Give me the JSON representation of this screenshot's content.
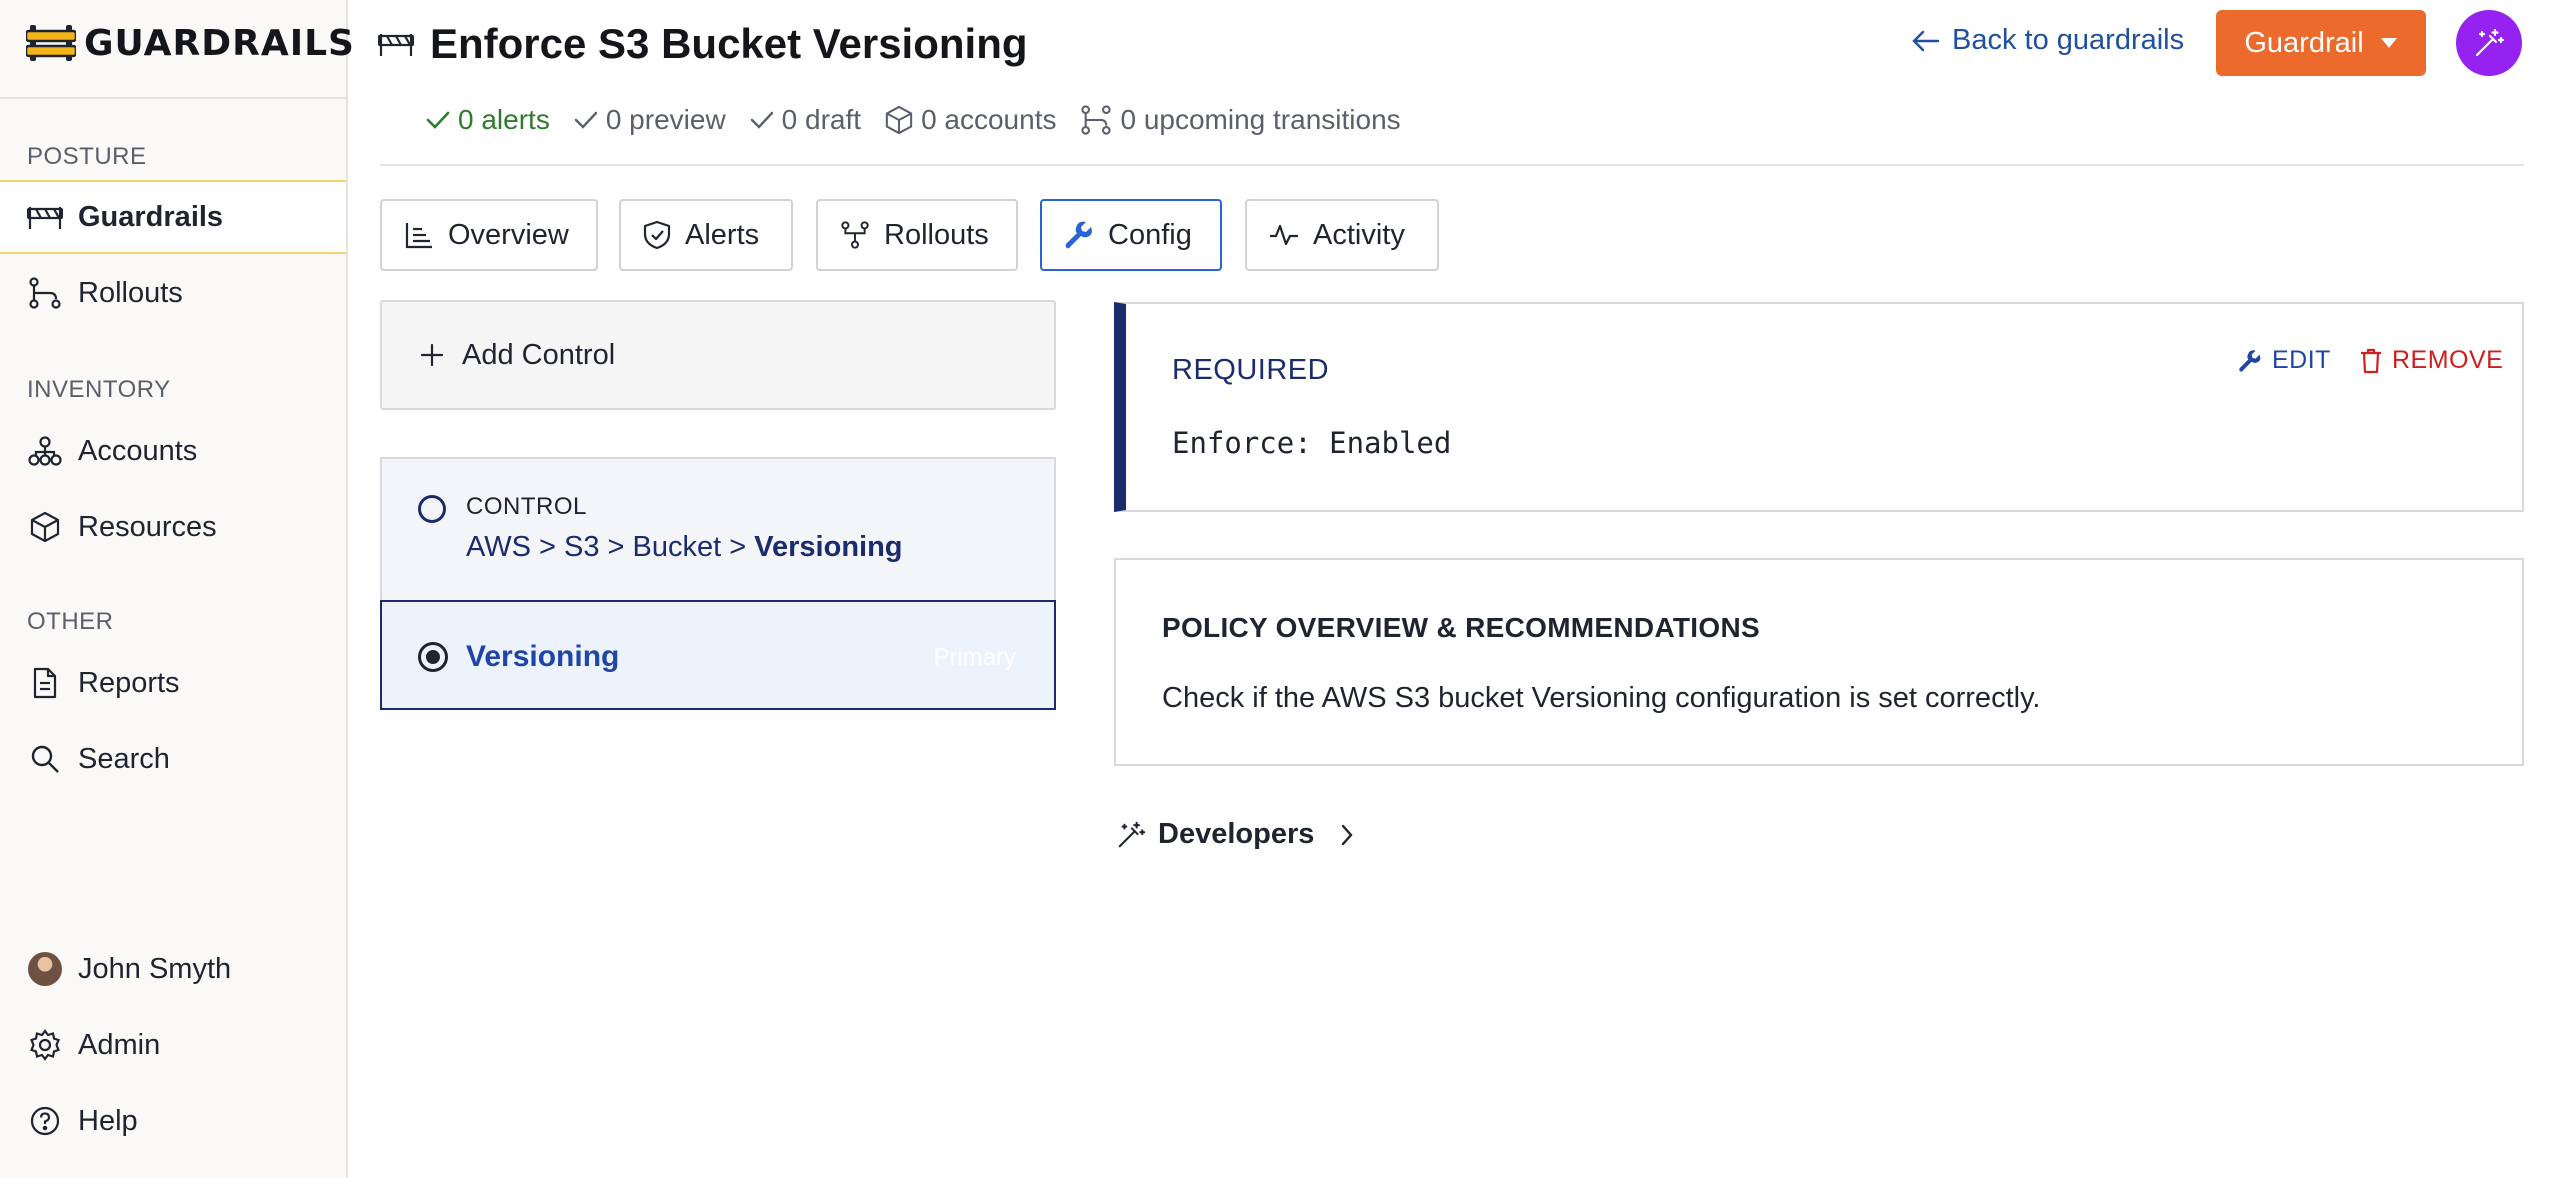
{
  "brand": {
    "name": "GUARDRAILS"
  },
  "sidebar": {
    "sections": [
      {
        "label": "POSTURE"
      },
      {
        "label": "INVENTORY"
      },
      {
        "label": "OTHER"
      }
    ],
    "items": [
      {
        "label": "Guardrails",
        "icon": "guardrails-icon",
        "active": true
      },
      {
        "label": "Rollouts",
        "icon": "rollouts-icon"
      },
      {
        "label": "Accounts",
        "icon": "accounts-icon"
      },
      {
        "label": "Resources",
        "icon": "cube-icon"
      },
      {
        "label": "Reports",
        "icon": "file-icon"
      },
      {
        "label": "Search",
        "icon": "search-icon"
      }
    ],
    "user": {
      "name": "John Smyth"
    },
    "admin": "Admin",
    "help": "Help"
  },
  "header": {
    "title": "Enforce S3 Bucket Versioning",
    "back_label": "Back to guardrails",
    "guardrail_button": "Guardrail",
    "stats": {
      "alerts": "0 alerts",
      "preview": "0 preview",
      "draft": "0 draft",
      "accounts": "0 accounts",
      "transitions": "0 upcoming transitions"
    }
  },
  "tabs": [
    {
      "label": "Overview"
    },
    {
      "label": "Alerts"
    },
    {
      "label": "Rollouts"
    },
    {
      "label": "Config",
      "active": true
    },
    {
      "label": "Activity"
    }
  ],
  "controls": {
    "add_label": "Add Control",
    "kicker": "CONTROL",
    "path_prefix": "AWS > S3 > Bucket > ",
    "path_last": "Versioning",
    "selected": {
      "label": "Versioning",
      "badge": "Primary"
    }
  },
  "config": {
    "status": "REQUIRED",
    "edit_label": "EDIT",
    "remove_label": "REMOVE",
    "value": "Enforce: Enabled"
  },
  "policy": {
    "heading": "POLICY OVERVIEW & RECOMMENDATIONS",
    "text": "Check if the AWS S3 bucket Versioning configuration is set correctly."
  },
  "developers": {
    "label": "Developers"
  },
  "colors": {
    "accent_orange": "#ec6a2c",
    "magic_purple": "#9522f0",
    "navy": "#1b2c6e",
    "link_blue": "#1f4fa0",
    "danger_red": "#d01e1e",
    "success_green": "#2f7a2b"
  }
}
